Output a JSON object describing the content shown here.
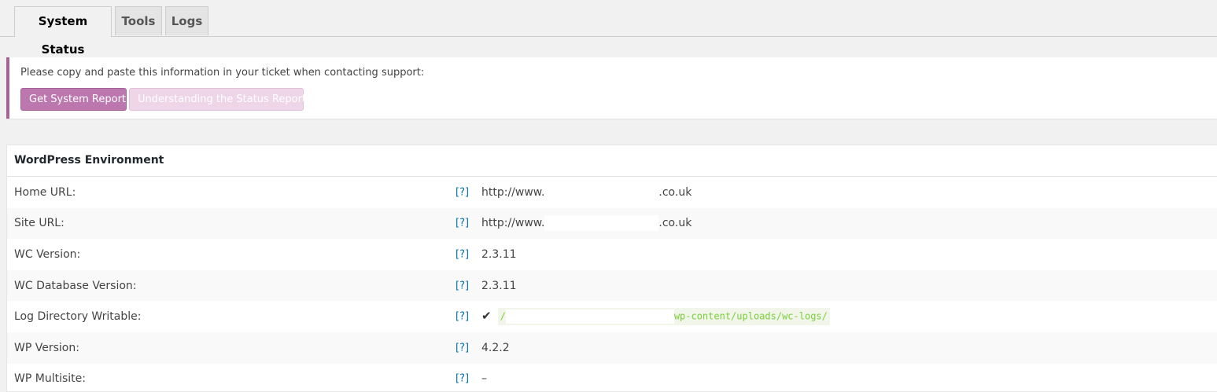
{
  "tabs": [
    {
      "label": "System Status",
      "active": true
    },
    {
      "label": "Tools",
      "active": false
    },
    {
      "label": "Logs",
      "active": false
    }
  ],
  "notice": {
    "text": "Please copy and paste this information in your ticket when contacting support:",
    "primary_button": "Get System Report",
    "secondary_button": "Understanding the Status Report",
    "accent_color": "#a46497"
  },
  "table": {
    "header": "WordPress Environment",
    "help_label": "[?]",
    "rows": [
      {
        "label": "Home URL:",
        "prefix": "http://www.",
        "suffix": ".co.uk"
      },
      {
        "label": "Site URL:",
        "prefix": "http://www.",
        "suffix": ".co.uk"
      },
      {
        "label": "WC Version:",
        "value": "2.3.11"
      },
      {
        "label": "WC Database Version:",
        "value": "2.3.11"
      },
      {
        "label": "Log Directory Writable:",
        "check": "✔",
        "path_start": "/",
        "path_end": "wp-content/uploads/wc-logs/"
      },
      {
        "label": "WP Version:",
        "value": "4.2.2"
      },
      {
        "label": "WP Multisite:",
        "value": "–"
      }
    ]
  }
}
